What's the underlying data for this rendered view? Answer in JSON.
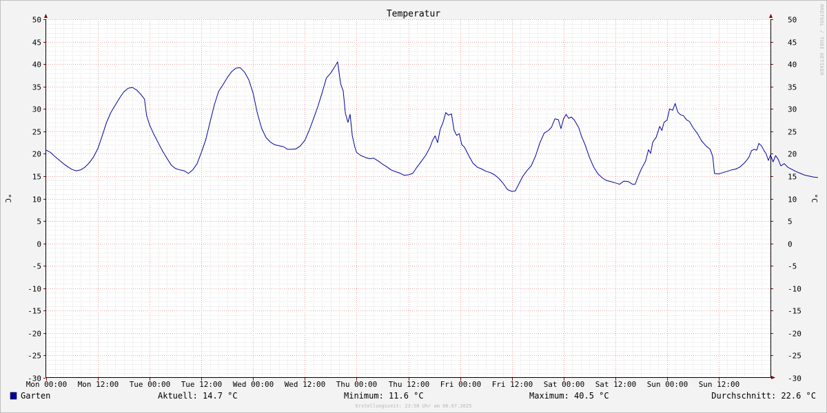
{
  "chart_data": {
    "type": "line",
    "title": "Temperatur",
    "ylabel": "°C",
    "y_ticks": [
      50,
      45,
      40,
      35,
      30,
      25,
      20,
      15,
      10,
      5,
      0,
      -5,
      -10,
      -15,
      -20,
      -25,
      -30
    ],
    "ylim": [
      -30,
      50
    ],
    "x_ticks": [
      "Mon 00:00",
      "Mon 12:00",
      "Tue 00:00",
      "Tue 12:00",
      "Wed 00:00",
      "Wed 12:00",
      "Thu 00:00",
      "Thu 12:00",
      "Fri 00:00",
      "Fri 12:00",
      "Sat 00:00",
      "Sat 12:00",
      "Sun 00:00",
      "Sun 12:00"
    ],
    "x_unit": "hours since Mon 00:00",
    "xlim": [
      0,
      168
    ],
    "grid": true,
    "series": [
      {
        "name": "Garten",
        "color": "#0000a0",
        "points": [
          [
            0,
            20.8
          ],
          [
            1,
            20.3
          ],
          [
            2,
            19.4
          ],
          [
            3,
            18.6
          ],
          [
            4,
            17.8
          ],
          [
            5,
            17.1
          ],
          [
            6,
            16.5
          ],
          [
            7,
            16.2
          ],
          [
            8,
            16.4
          ],
          [
            9,
            17.0
          ],
          [
            10,
            18.0
          ],
          [
            11,
            19.3
          ],
          [
            12,
            21.2
          ],
          [
            13,
            24.0
          ],
          [
            14,
            27.0
          ],
          [
            15,
            29.2
          ],
          [
            16,
            30.8
          ],
          [
            17,
            32.4
          ],
          [
            18,
            33.8
          ],
          [
            19,
            34.6
          ],
          [
            20,
            34.8
          ],
          [
            21,
            34.2
          ],
          [
            22,
            33.2
          ],
          [
            22.8,
            32.2
          ],
          [
            23.3,
            28.5
          ],
          [
            24,
            26.4
          ],
          [
            25,
            24.3
          ],
          [
            26,
            22.4
          ],
          [
            27,
            20.6
          ],
          [
            28,
            19.0
          ],
          [
            29,
            17.5
          ],
          [
            30,
            16.7
          ],
          [
            31,
            16.4
          ],
          [
            32,
            16.2
          ],
          [
            33,
            15.6
          ],
          [
            34,
            16.4
          ],
          [
            35,
            17.8
          ],
          [
            36,
            20.3
          ],
          [
            37,
            23.1
          ],
          [
            38,
            27.0
          ],
          [
            39,
            30.9
          ],
          [
            40,
            33.9
          ],
          [
            41,
            35.4
          ],
          [
            42,
            37.0
          ],
          [
            43,
            38.3
          ],
          [
            44,
            39.1
          ],
          [
            45,
            39.2
          ],
          [
            46,
            38.2
          ],
          [
            47,
            36.5
          ],
          [
            48,
            33.5
          ],
          [
            49,
            29.0
          ],
          [
            50,
            25.6
          ],
          [
            51,
            23.6
          ],
          [
            52,
            22.6
          ],
          [
            53,
            22.0
          ],
          [
            54,
            21.8
          ],
          [
            55,
            21.6
          ],
          [
            56,
            21.0
          ],
          [
            57,
            21.0
          ],
          [
            58,
            21.1
          ],
          [
            59,
            21.8
          ],
          [
            60,
            23.0
          ],
          [
            61,
            25.2
          ],
          [
            62,
            27.8
          ],
          [
            63,
            30.5
          ],
          [
            64,
            33.6
          ],
          [
            65,
            36.9
          ],
          [
            66,
            38.0
          ],
          [
            67,
            39.5
          ],
          [
            67.6,
            40.5
          ],
          [
            68.3,
            35.6
          ],
          [
            68.9,
            34.0
          ],
          [
            69.4,
            29.0
          ],
          [
            70,
            27.0
          ],
          [
            70.5,
            28.8
          ],
          [
            71,
            24.0
          ],
          [
            71.6,
            21.5
          ],
          [
            72,
            20.3
          ],
          [
            73,
            19.6
          ],
          [
            74,
            19.2
          ],
          [
            75,
            18.9
          ],
          [
            76,
            19.0
          ],
          [
            77,
            18.4
          ],
          [
            78,
            17.7
          ],
          [
            79,
            17.1
          ],
          [
            80,
            16.4
          ],
          [
            81,
            16.0
          ],
          [
            82,
            15.7
          ],
          [
            83,
            15.2
          ],
          [
            84,
            15.3
          ],
          [
            85,
            15.6
          ],
          [
            86,
            17.0
          ],
          [
            87,
            18.3
          ],
          [
            88,
            19.6
          ],
          [
            89,
            21.4
          ],
          [
            89.6,
            22.9
          ],
          [
            90.2,
            24.0
          ],
          [
            90.8,
            22.5
          ],
          [
            91.4,
            25.5
          ],
          [
            92,
            26.8
          ],
          [
            92.7,
            29.2
          ],
          [
            93.3,
            28.6
          ],
          [
            94,
            28.9
          ],
          [
            94.6,
            25.3
          ],
          [
            95.2,
            24.1
          ],
          [
            95.8,
            24.5
          ],
          [
            96.4,
            22.0
          ],
          [
            97,
            21.5
          ],
          [
            98,
            19.6
          ],
          [
            99,
            17.9
          ],
          [
            100,
            17.0
          ],
          [
            101,
            16.6
          ],
          [
            102,
            16.1
          ],
          [
            103,
            15.8
          ],
          [
            104,
            15.3
          ],
          [
            105,
            14.5
          ],
          [
            106,
            13.4
          ],
          [
            107,
            12.0
          ],
          [
            108,
            11.6
          ],
          [
            108.8,
            11.7
          ],
          [
            109.5,
            13.0
          ],
          [
            110.5,
            14.9
          ],
          [
            111.5,
            16.2
          ],
          [
            112.5,
            17.3
          ],
          [
            113.5,
            19.5
          ],
          [
            114.5,
            22.4
          ],
          [
            115.5,
            24.6
          ],
          [
            116.5,
            25.2
          ],
          [
            117.2,
            25.9
          ],
          [
            118,
            27.8
          ],
          [
            118.8,
            27.6
          ],
          [
            119.4,
            25.6
          ],
          [
            120,
            27.8
          ],
          [
            120.6,
            28.8
          ],
          [
            121.2,
            27.9
          ],
          [
            121.8,
            28.2
          ],
          [
            122.5,
            27.5
          ],
          [
            123.5,
            25.9
          ],
          [
            124.2,
            23.8
          ],
          [
            125,
            22.0
          ],
          [
            126,
            19.2
          ],
          [
            127,
            17.0
          ],
          [
            128,
            15.5
          ],
          [
            129,
            14.6
          ],
          [
            130,
            14.0
          ],
          [
            131,
            13.8
          ],
          [
            132,
            13.5
          ],
          [
            133,
            13.2
          ],
          [
            134,
            13.9
          ],
          [
            135,
            13.8
          ],
          [
            136,
            13.2
          ],
          [
            136.6,
            13.2
          ],
          [
            137.2,
            14.7
          ],
          [
            138,
            16.5
          ],
          [
            139,
            18.3
          ],
          [
            139.7,
            20.9
          ],
          [
            140.2,
            20.1
          ],
          [
            140.7,
            22.6
          ],
          [
            141.5,
            23.7
          ],
          [
            142.3,
            26.1
          ],
          [
            142.8,
            25.2
          ],
          [
            143.3,
            27.0
          ],
          [
            144,
            27.5
          ],
          [
            144.6,
            30.0
          ],
          [
            145.3,
            29.7
          ],
          [
            145.9,
            31.2
          ],
          [
            146.5,
            29.3
          ],
          [
            147.1,
            28.7
          ],
          [
            147.8,
            28.5
          ],
          [
            148.5,
            27.6
          ],
          [
            149.2,
            27.2
          ],
          [
            150,
            25.9
          ],
          [
            151,
            24.6
          ],
          [
            152,
            22.9
          ],
          [
            153,
            21.8
          ],
          [
            154,
            21.0
          ],
          [
            154.6,
            19.4
          ],
          [
            155,
            15.6
          ],
          [
            156,
            15.5
          ],
          [
            157,
            15.8
          ],
          [
            158,
            16.1
          ],
          [
            159,
            16.4
          ],
          [
            160,
            16.6
          ],
          [
            161,
            17.1
          ],
          [
            162,
            18.0
          ],
          [
            163,
            19.2
          ],
          [
            163.6,
            20.7
          ],
          [
            164.2,
            21.0
          ],
          [
            164.8,
            20.8
          ],
          [
            165.3,
            22.3
          ],
          [
            165.9,
            21.8
          ],
          [
            166.5,
            20.7
          ],
          [
            167,
            20.0
          ],
          [
            167.5,
            18.5
          ],
          [
            168,
            19.7
          ],
          [
            168.6,
            18.2
          ],
          [
            169.2,
            19.6
          ],
          [
            169.8,
            18.7
          ],
          [
            170.4,
            17.3
          ],
          [
            171.2,
            17.8
          ],
          [
            172,
            17.0
          ],
          [
            173,
            16.5
          ],
          [
            174,
            16.0
          ],
          [
            175,
            15.6
          ],
          [
            176,
            15.2
          ],
          [
            177,
            15.0
          ],
          [
            178,
            14.8
          ],
          [
            179,
            14.7
          ]
        ]
      }
    ]
  },
  "watermark": "RRDTOOL / TOBI OETIKER",
  "legend": {
    "series_name": "Garten",
    "series_color": "#0000a0",
    "aktuell": "Aktuell: 14.7 °C",
    "minimum": "Minimum: 11.6 °C",
    "maximum": "Maximum: 40.5 °C",
    "durchschnitt": "Durchschnitt: 22.6 °C"
  },
  "footer": "Erstellungszeit: 23:58 Uhr am 06.07.2025"
}
